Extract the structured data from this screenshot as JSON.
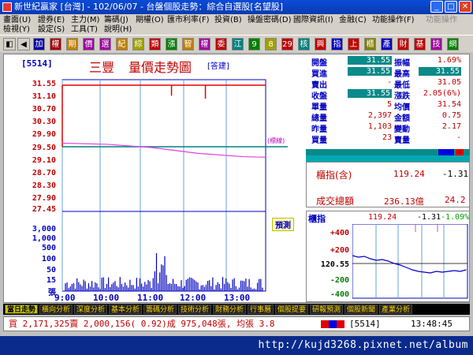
{
  "window": {
    "title": "新世紀贏家 [台灣] - 102/06/07 - 台盤個股走勢：綜合自選股[名望股]"
  },
  "menu": {
    "row1": [
      "畫面(U)",
      "證券(E)",
      "主力(M)",
      "籌碼(J)",
      "期權(O)",
      "匯市利率(F)",
      "投資(B)",
      "操盤密碼(D)",
      "國際資訊(I)",
      "金融(C)",
      "功能操作(F)",
      "功能操作"
    ],
    "row2": [
      "檢視(Y)",
      "設定(S)",
      "工具(T)",
      "說明(H)"
    ]
  },
  "toolbar": {
    "buttons": [
      "加",
      "權",
      "期",
      "價",
      "選",
      "紀",
      "綜",
      "類",
      "漲",
      "智",
      "權",
      "委",
      "江",
      "9",
      "8",
      "29",
      "核",
      "興",
      "指",
      "上",
      "櫃",
      "產",
      "財",
      "基",
      "技",
      "網"
    ],
    "colors": [
      "#0000a0",
      "#a00000",
      "#c08000",
      "#a000a0",
      "#a000a0",
      "#c08000",
      "#a0a000",
      "#c00000",
      "#008000",
      "#c08000",
      "#a000a0",
      "#c00000",
      "#008080",
      "#008000",
      "#a0a000",
      "#c00000",
      "#008080",
      "#c00000",
      "#0000c0",
      "#c00000",
      "#808000",
      "#0000c0",
      "#c00000",
      "#c00000",
      "#a000a0",
      "#008000"
    ]
  },
  "stock": {
    "code_label": "[5514]",
    "name": "三豐",
    "chart_title": "量價走勢圖",
    "tag": "[答建]"
  },
  "chart_data": {
    "type": "line",
    "title": "量價走勢圖",
    "x_ticks": [
      "9:00",
      "10:00",
      "11:00",
      "12:00",
      "13:00"
    ],
    "y_price_ticks": [
      "31.55",
      "31.10",
      "30.70",
      "30.30",
      "29.90",
      "29.50",
      "29.10",
      "28.70",
      "28.30",
      "27.90",
      "27.45"
    ],
    "y_volume_ticks": [
      "3,000",
      "1,000",
      "500",
      "100",
      "50",
      "15",
      "張"
    ],
    "reference_price": 29.5,
    "reference_label": "(標線)",
    "predict_label": "預測",
    "average_price_line": {
      "x": [
        "9:00",
        "10:00",
        "11:00",
        "12:00",
        "13:00",
        "13:30"
      ],
      "y": [
        29.62,
        29.58,
        29.47,
        29.28,
        29.17,
        29.15
      ]
    },
    "price_series": {
      "x": [
        "9:00",
        "13:30"
      ],
      "y": [
        31.55,
        31.55
      ]
    },
    "price_dips": [
      {
        "time": "11:25",
        "low": 31.2
      },
      {
        "time": "12:10",
        "low": 31.1
      }
    ]
  },
  "quote": {
    "rows": [
      {
        "l1": "開盤",
        "v1": "31.55",
        "l2": "振幅",
        "v2": "1.69%",
        "v1_box": true,
        "v2_box": false
      },
      {
        "l1": "買進",
        "v1": "31.55",
        "l2": "最高",
        "v2": "31.55",
        "v1_box": true,
        "v2_box": true
      },
      {
        "l1": "賣出",
        "v1": "-",
        "l2": "最低",
        "v2": "31.05",
        "v1_box": false,
        "v2_box": false
      },
      {
        "l1": "收盤",
        "v1": "31.55",
        "l2": "漲跌",
        "v2": "2.05(6%)",
        "v1_box": true,
        "v2_box": false
      },
      {
        "l1": "單量",
        "v1": "5",
        "l2": "均價",
        "v2": "31.54",
        "v1_box": false,
        "v2_box": false
      },
      {
        "l1": "總量",
        "v1": "2,397",
        "l2": "金額",
        "v2": "0.75",
        "v1_box": false,
        "v2_box": false
      },
      {
        "l1": "昨量",
        "v1": "1,103",
        "l2": "變動",
        "v2": "2.17",
        "v1_box": false,
        "v2_box": false
      },
      {
        "l1": "買量",
        "v1": "23",
        "l2": "賣量",
        "v2": "-",
        "v1_box": false,
        "v2_box": false
      }
    ]
  },
  "index_panel": {
    "label": "櫃指(含)",
    "value": "119.24",
    "change": "-1.31",
    "turnover_label": "成交總額",
    "turnover_value": "236.13億",
    "turnover_change": "24.2"
  },
  "mini_chart": {
    "label": "櫃指",
    "value": "119.24",
    "change": "-1.31",
    "pct": "-1.09%",
    "y_ticks": [
      "+400",
      "+200",
      "120.55",
      "-200",
      "-400"
    ]
  },
  "tabs": [
    "當日走勢",
    "橫向分析",
    "深度分析",
    "基本分析",
    "籌碼分析",
    "技術分析",
    "財務分析",
    "行事曆",
    "個股提要",
    "研報預測",
    "個股新聞",
    "產業分析"
  ],
  "status": {
    "text": "買 2,171,325賣 2,000,156( 0.92)成 975,048張, 均張 3.8",
    "code": "[5514]",
    "time": "13:48:45"
  },
  "footer": {
    "url": "http://kujd3268.pixnet.net/album"
  }
}
